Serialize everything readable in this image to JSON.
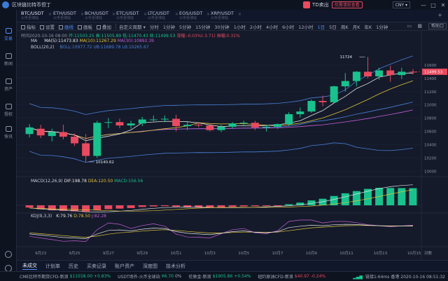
{
  "titlebar": {
    "app_title": "区块链比特币但丁",
    "td_label": "TD卖出",
    "promo_label": "仅需请前查看",
    "currency": "CNY",
    "minimize": "—",
    "maximize": "□",
    "close": "✕"
  },
  "sidebar": [
    {
      "label": "交易",
      "active": true
    },
    {
      "label": "新闻",
      "active": false
    },
    {
      "label": "资产",
      "active": false
    },
    {
      "label": "授权",
      "active": false
    },
    {
      "label": "快讯",
      "active": false
    }
  ],
  "symbol_tabs": [
    {
      "name": "BTC/USDT",
      "sub": "火币全球站",
      "active": true
    },
    {
      "name": "ETH/USDT",
      "sub": "火币全球站",
      "active": false
    },
    {
      "name": "BCH/USDT",
      "sub": "火币全球站",
      "active": false
    },
    {
      "name": "ETC/USDT",
      "sub": "火币全球站",
      "active": false
    },
    {
      "name": "LTC/USDT",
      "sub": "火币全球站",
      "active": false
    },
    {
      "name": "EOS/USDT",
      "sub": "火币全球站",
      "active": false
    },
    {
      "name": "XRP/USDT",
      "sub": "火币全球站",
      "active": false
    }
  ],
  "toolbar": {
    "items": [
      {
        "label": "指标",
        "active": false
      },
      {
        "label": "设置",
        "active": false
      },
      {
        "label": "画线",
        "active": true
      },
      {
        "label": "画板",
        "active": false
      },
      {
        "label": "叠加",
        "active": false
      }
    ],
    "period_selector": "自定义周期",
    "periods": [
      {
        "label": "分时",
        "active": false
      },
      {
        "label": "1分钟",
        "active": false
      },
      {
        "label": "5分钟",
        "active": false
      },
      {
        "label": "15分钟",
        "active": false
      },
      {
        "label": "30分钟",
        "active": false
      },
      {
        "label": "1小时",
        "active": false
      },
      {
        "label": "2小时",
        "active": false
      },
      {
        "label": "4小时",
        "active": false
      },
      {
        "label": "6小时",
        "active": false
      },
      {
        "label": "12小时",
        "active": false
      },
      {
        "label": "1日",
        "active": true
      },
      {
        "label": "5日",
        "active": false
      },
      {
        "label": "周K",
        "active": false
      },
      {
        "label": "月K",
        "active": false
      },
      {
        "label": "年K",
        "active": false
      },
      {
        "label": "1分钟",
        "active": false
      }
    ],
    "help": "帮助口"
  },
  "info": {
    "line1": {
      "time": "时间2020-10-16 08:00",
      "open": "开:11503.25",
      "high": "高:11505.89",
      "low": "低:11470.43",
      "close": "收:11499.53",
      "change": "涨幅:-0.03%(-3.71)",
      "amplitude": "振幅:0.31%"
    },
    "ma_line": {
      "title": "MA",
      "ma5": "MA(5):11473.83",
      "ma10": "MA(10):11267.29",
      "ma30": "MA(30):10892.39"
    },
    "boll_line": {
      "title": "BOLL(20,2)",
      "mid": "BOLL:10977.72",
      "ub": "UB:11689.78",
      "lb": "LB:10265.67"
    },
    "macd_line": {
      "title": "MACD(12,26,9)",
      "dif": "DIF:198.78",
      "dea": "DEA:120.50",
      "macd": "MACD:156.56"
    },
    "kdj_line": {
      "title": "KDJ(9,3,3)",
      "k": "K:79.76",
      "d": "D:78.50",
      "j": "J:82.28"
    }
  },
  "annotations": {
    "high_label": "11724",
    "low_label": "10140.62",
    "current_price": "11499.53",
    "axis_label": "对数"
  },
  "colors": {
    "up": "#19c28d",
    "down": "#e84a5f",
    "ma5": "#e6e6e6",
    "ma10": "#e0c33a",
    "ma30": "#c35fd6",
    "boll": "#4a7fd6",
    "k": "#e6e6e6",
    "d": "#e0c33a",
    "j": "#c35fd6"
  },
  "chart_data": {
    "type": "candlestick",
    "x_ticks": [
      "9月23",
      "9月25",
      "9月27",
      "9月29",
      "10月1",
      "10月3",
      "10月5",
      "10月7",
      "10月9",
      "10月11",
      "10月13",
      "10月15"
    ],
    "ohlc": [
      [
        10560,
        10710,
        10510,
        10660
      ],
      [
        10640,
        10700,
        10500,
        10540
      ],
      [
        10530,
        10640,
        10450,
        10590
      ],
      [
        10590,
        10700,
        10480,
        10520
      ],
      [
        10520,
        10570,
        10380,
        10420
      ],
      [
        10420,
        10560,
        10140.62,
        10230
      ],
      [
        10230,
        10760,
        10200,
        10730
      ],
      [
        10730,
        10800,
        10650,
        10740
      ],
      [
        10740,
        10790,
        10650,
        10690
      ],
      [
        10690,
        10760,
        10640,
        10720
      ],
      [
        10720,
        10820,
        10680,
        10780
      ],
      [
        10780,
        10840,
        10740,
        10780
      ],
      [
        10780,
        10840,
        10740,
        10790
      ],
      [
        10790,
        10850,
        10600,
        10680
      ],
      [
        10680,
        10740,
        10620,
        10700
      ],
      [
        10700,
        10740,
        10660,
        10690
      ],
      [
        10690,
        10720,
        10600,
        10620
      ],
      [
        10620,
        10700,
        10590,
        10670
      ],
      [
        10670,
        10740,
        10650,
        10720
      ],
      [
        10720,
        10760,
        10680,
        10730
      ],
      [
        10730,
        10760,
        10620,
        10660
      ],
      [
        10660,
        10700,
        10600,
        10670
      ],
      [
        10670,
        10720,
        10640,
        10710
      ],
      [
        10710,
        10890,
        10680,
        10860
      ],
      [
        10860,
        10960,
        10810,
        10900
      ],
      [
        10900,
        11080,
        10880,
        11060
      ],
      [
        11060,
        11140,
        10980,
        11040
      ],
      [
        11040,
        11290,
        11030,
        11280
      ],
      [
        11280,
        11480,
        11200,
        11360
      ],
      [
        11360,
        11510,
        11280,
        11500
      ],
      [
        11500,
        11724,
        11400,
        11430
      ],
      [
        11430,
        11560,
        11380,
        11520
      ],
      [
        11520,
        11590,
        11350,
        11450
      ],
      [
        11450,
        11560,
        11390,
        11500
      ],
      [
        11500,
        11540,
        11460,
        11499.53
      ]
    ],
    "macd_hist": [
      -20,
      -35,
      -45,
      -50,
      -55,
      -60,
      -45,
      -35,
      -30,
      -25,
      -15,
      -10,
      -8,
      -12,
      -18,
      -20,
      -22,
      -18,
      -14,
      -10,
      -8,
      -6,
      -3,
      10,
      25,
      45,
      60,
      85,
      110,
      130,
      150,
      160,
      158,
      157,
      156.56
    ],
    "kdj": {
      "k": [
        45,
        40,
        35,
        30,
        28,
        25,
        45,
        60,
        62,
        58,
        65,
        70,
        68,
        55,
        48,
        45,
        42,
        48,
        55,
        58,
        52,
        50,
        55,
        72,
        78,
        82,
        80,
        84,
        86,
        85,
        82,
        80,
        78,
        79,
        79.76
      ],
      "d": [
        50,
        46,
        42,
        38,
        34,
        31,
        36,
        44,
        50,
        53,
        57,
        61,
        63,
        60,
        56,
        52,
        49,
        49,
        51,
        53,
        53,
        52,
        53,
        59,
        65,
        71,
        74,
        77,
        80,
        81,
        81,
        80,
        79,
        79,
        78.5
      ],
      "j": [
        35,
        28,
        21,
        14,
        16,
        13,
        63,
        92,
        86,
        68,
        81,
        88,
        78,
        45,
        32,
        31,
        28,
        46,
        63,
        68,
        50,
        46,
        59,
        98,
        104,
        104,
        92,
        98,
        98,
        93,
        84,
        80,
        76,
        79,
        82.28
      ]
    },
    "y_ticks": [
      11600,
      11400,
      11200,
      11000,
      10800,
      10600,
      10400,
      10200,
      10000
    ],
    "ylim": [
      9950,
      11800
    ]
  },
  "bottom_tabs": [
    {
      "label": "未成交",
      "active": true
    },
    {
      "label": "计划单",
      "active": false
    },
    {
      "label": "历史",
      "active": false
    },
    {
      "label": "买卖记录",
      "active": false
    },
    {
      "label": "账户资产",
      "active": false
    },
    {
      "label": "深度图",
      "active": false
    },
    {
      "label": "技术分析",
      "active": false
    }
  ],
  "statusbar": [
    {
      "name": "CME比特币期货CFD-新浪",
      "price": "$11558.00",
      "change": "+0.83%",
      "dir": "up"
    },
    {
      "name": "USDT场外-火币全球站",
      "price": "¥6.70",
      "change": "0%",
      "dir": "up"
    },
    {
      "name": "伦敦金-新浪",
      "price": "$1905.86",
      "change": "+0.54%",
      "dir": "up"
    },
    {
      "name": "纽约原油CFD-新浪",
      "price": "$40.97",
      "change": "-0.24%",
      "dir": "down"
    }
  ],
  "connection": {
    "signal": "链接1:64ms",
    "region": "香港",
    "datetime": "2020-10-16 08:51:32"
  }
}
